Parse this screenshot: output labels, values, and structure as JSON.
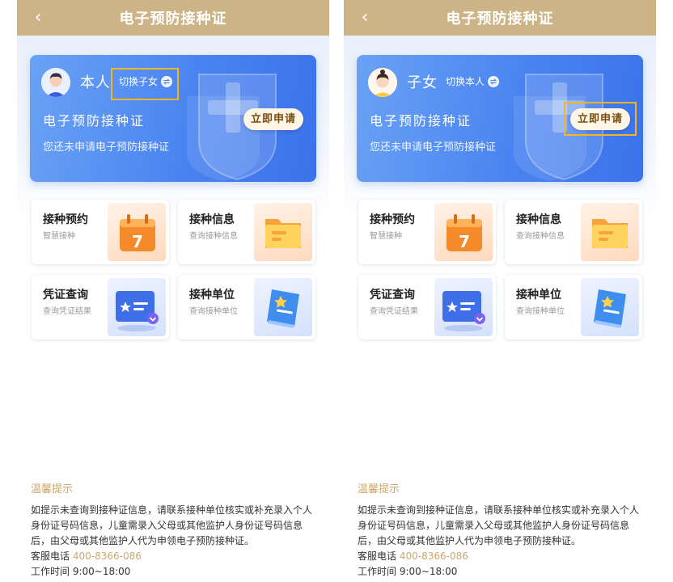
{
  "nav": {
    "title": "电子预防接种证",
    "back_icon": "‹"
  },
  "screens": [
    {
      "who": "本人",
      "switch_label": "切换子女",
      "card_title": "电子预防接种证",
      "card_sub": "您还未申请电子预防接种证",
      "apply_label": "立即申请",
      "highlight": "switch"
    },
    {
      "who": "子女",
      "switch_label": "切换本人",
      "card_title": "电子预防接种证",
      "card_sub": "您还未申请电子预防接种证",
      "apply_label": "立即申请",
      "highlight": "apply"
    }
  ],
  "tiles": [
    {
      "title": "接种预约",
      "sub": "智慧接种",
      "icon": "calendar-icon"
    },
    {
      "title": "接种信息",
      "sub": "查询接种信息",
      "icon": "folder-icon"
    },
    {
      "title": "凭证查询",
      "sub": "查询凭证结果",
      "icon": "certificate-icon"
    },
    {
      "title": "接种单位",
      "sub": "查询接种单位",
      "icon": "book-icon"
    }
  ],
  "calendar_number": "7",
  "tips": {
    "title": "温馨提示",
    "body": "如提示未查询到接种证信息，请联系接种单位核实或补充录入个人身份证号码信息，儿童需录入父母或其他监护人身份证号码信息后，由父母或其他监护人代为申领电子预防接种证。",
    "phone_label": "客服电话",
    "phone": "400-8366-086",
    "hours": "工作时间 9:00~18:00"
  },
  "colors": {
    "nav": "#cdb487",
    "accent": "#3b72ea",
    "highlight": "#f3b61c",
    "tip": "#cda66c"
  }
}
